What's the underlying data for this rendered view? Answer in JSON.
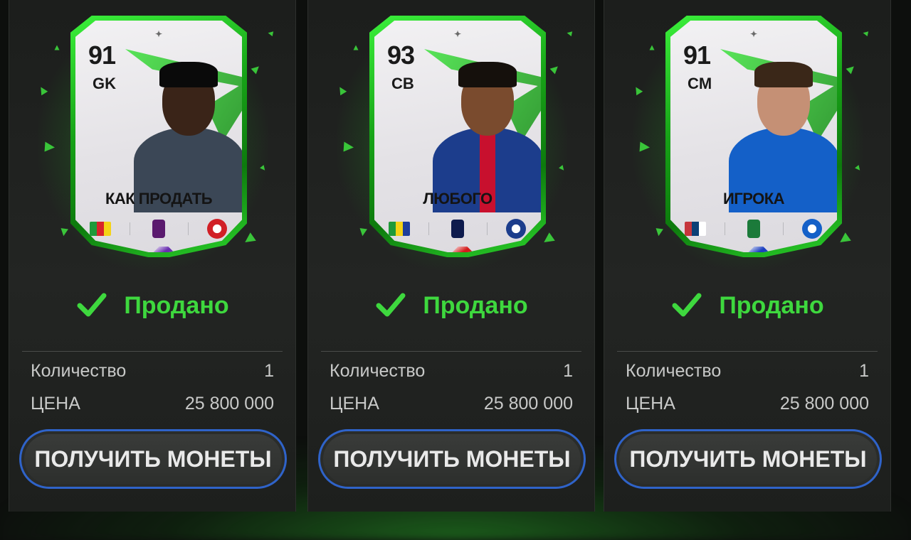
{
  "sold_label": "Продано",
  "quantity_label": "Количество",
  "price_label": "ЦЕНА",
  "button_label": "ПОЛУЧИТЬ МОНЕТЫ",
  "cards": [
    {
      "rating": "91",
      "position": "GK",
      "name": "КАК ПРОДАТЬ",
      "quantity": "1",
      "price": "25 800 000",
      "skin": "#3a2418",
      "hair": "#0a0a0a",
      "shirt": "#3b4756",
      "stripe": "#3b4756",
      "flag_colors": [
        "#1f9a3a",
        "#d8232a",
        "#f4d316"
      ],
      "league_color": "#5a1a6e",
      "club_color": "#d11f26",
      "gem_color": "#6a2fb0",
      "flag_icon": "cameroon-flag-icon",
      "league_icon": "premier-league-icon",
      "club_icon": "manchester-united-crest-icon"
    },
    {
      "rating": "93",
      "position": "CB",
      "name": "ЛЮБОГО",
      "quantity": "1",
      "price": "25 800 000",
      "skin": "#7a4b2e",
      "hair": "#15100c",
      "shirt": "#1c3d8c",
      "stripe": "#c8102e",
      "flag_colors": [
        "#1f9a3a",
        "#f4d316",
        "#1e3f9c"
      ],
      "league_color": "#0e1b4d",
      "club_color": "#1c3d8c",
      "gem_color": "#d41c1c",
      "flag_icon": "brazil-flag-icon",
      "league_icon": "ligue-1-icon",
      "club_icon": "psg-crest-icon"
    },
    {
      "rating": "91",
      "position": "CM",
      "name": "ИГРОКА",
      "quantity": "1",
      "price": "25 800 000",
      "skin": "#c59075",
      "hair": "#3a2718",
      "shirt": "#1460c8",
      "stripe": "#1460c8",
      "flag_colors": [
        "#c6363c",
        "#0c4076",
        "#ffffff"
      ],
      "league_color": "#1b7a3a",
      "club_color": "#1460c8",
      "gem_color": "#1c3fc0",
      "flag_icon": "serbia-flag-icon",
      "league_icon": "saudi-pro-league-icon",
      "club_icon": "al-hilal-crest-icon"
    }
  ]
}
